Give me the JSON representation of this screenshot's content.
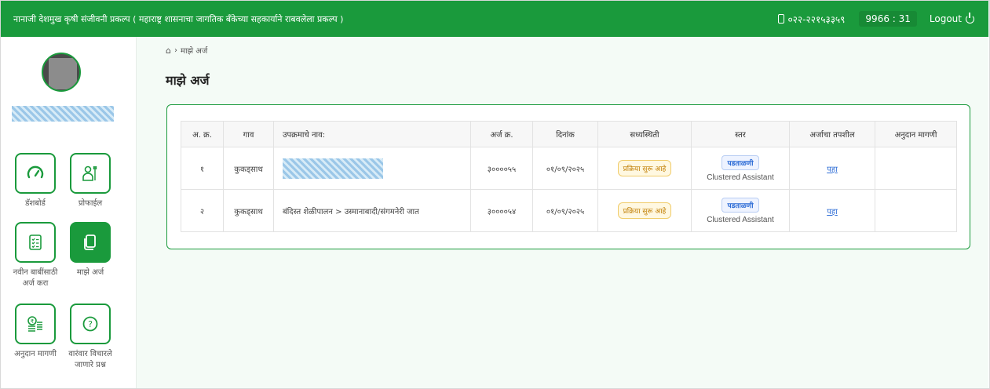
{
  "header": {
    "title": "नानाजी देशमुख कृषी संजीवनी प्रकल्प ( महाराष्ट्र शासनाचा जागतिक बँकेच्या सहकार्याने राबवलेला प्रकल्प )",
    "phone": "०२२-२२१५३३५९",
    "clock": "9966 : 31",
    "logout_label": "Logout"
  },
  "sidebar": {
    "username": "",
    "items": [
      {
        "label": "डॅशबोर्ड",
        "icon": "gauge-icon"
      },
      {
        "label": "प्रोफाईल",
        "icon": "farmer-profile-icon"
      },
      {
        "label": "नवीन बाबींसाठी अर्ज करा",
        "icon": "checklist-icon"
      },
      {
        "label": "माझे अर्ज",
        "icon": "documents-icon"
      },
      {
        "label": "अनुदान मागणी",
        "icon": "coins-icon"
      },
      {
        "label": "वारंवार विचारले जाणारे प्रश्न",
        "icon": "question-icon"
      }
    ]
  },
  "breadcrumb": {
    "current": "माझे अर्ज"
  },
  "page_title": "माझे अर्ज",
  "table": {
    "headers": [
      "अ. क्र.",
      "गाव",
      "उपक्रमाचे नाव:",
      "अर्ज क्र.",
      "दिनांक",
      "सध्यस्थिती",
      "स्तर",
      "अर्जाचा तपशील",
      "अनुदान मागणी"
    ],
    "rows": [
      {
        "sr": "१",
        "village": "कुकड्साथ",
        "scheme": "",
        "app_no": "३००००५५",
        "date": "०१/०९/२०२५",
        "status": "प्रक्रिया सुरू आहे",
        "level": "पडताळणी",
        "level_sub": "Clustered Assistant",
        "details": "पहा",
        "subsidy": ""
      },
      {
        "sr": "२",
        "village": "कुकड्साथ",
        "scheme": "बंदिस्त शेळीपालन > उस्मानाबादी/संगमनेरी जात",
        "app_no": "३००००५४",
        "date": "०१/०९/२०२५",
        "status": "प्रक्रिया सुरू आहे",
        "level": "पडताळणी",
        "level_sub": "Clustered Assistant",
        "details": "पहा",
        "subsidy": ""
      }
    ]
  },
  "colors": {
    "primary": "#1a9a3c",
    "background": "#f4fbf6"
  }
}
